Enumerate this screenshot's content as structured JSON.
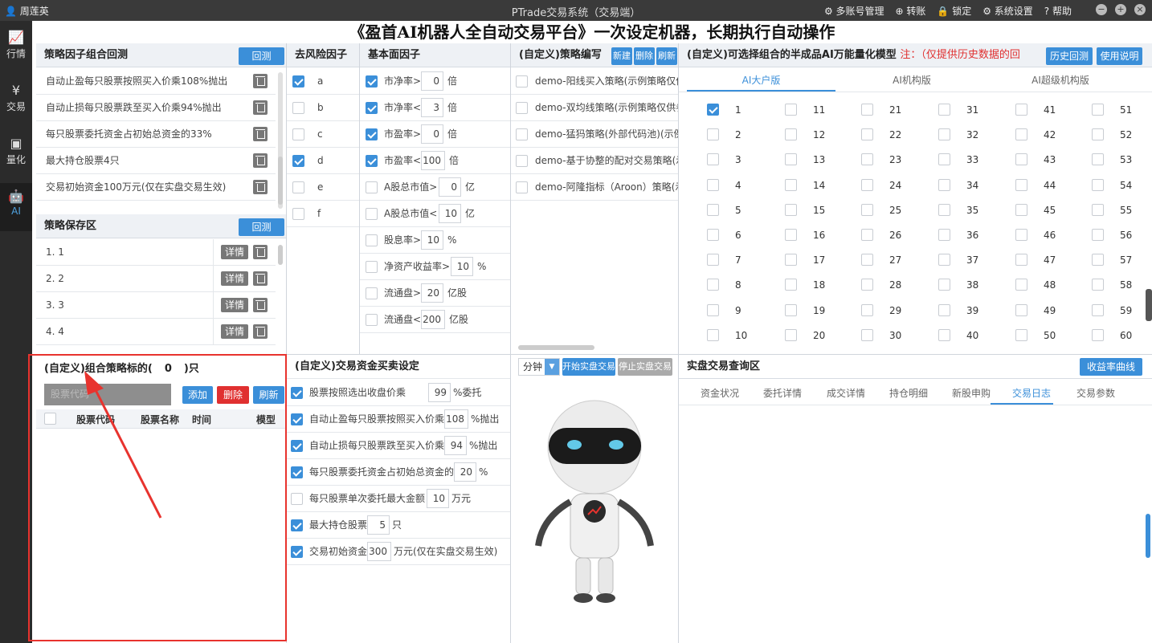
{
  "titlebar": {
    "user": "周莲英",
    "app_title": "PTrade交易系统（交易端）",
    "menu": [
      "多账号管理",
      "转账",
      "锁定",
      "系统设置",
      "帮助"
    ]
  },
  "sidebar": [
    {
      "label": "行情",
      "icon": "chart-icon"
    },
    {
      "label": "交易",
      "icon": "yen-icon"
    },
    {
      "label": "量化",
      "icon": "quant-icon"
    },
    {
      "label": "AI",
      "icon": "robot-icon"
    }
  ],
  "banner": "《盈首AI机器人全自动交易平台》一次设定机器，长期执行自动操作",
  "factor_backtest": {
    "title": "策略因子组合回测",
    "button": "回测",
    "items": [
      "自动止盈每只股票按照买入价乘108%抛出",
      "自动止损每只股票跌至买入价乘94%抛出",
      "每只股票委托资金占初始总资金的33%",
      "最大持仓股票4只",
      "交易初始资金100万元(仅在实盘交易生效)"
    ]
  },
  "strategy_save": {
    "title": "策略保存区",
    "button": "回测",
    "detail_label": "详情",
    "items": [
      "1.  1",
      "2.  2",
      "3.  3",
      "4.  4"
    ]
  },
  "custom_combo": {
    "title": "(自定义)组合策略标的(",
    "count": "0",
    "title_suffix": ")只",
    "input_placeholder": "股票代码",
    "add": "添加",
    "delete": "删除",
    "refresh": "刷新",
    "columns": [
      "股票代码",
      "股票名称",
      "时间",
      "模型"
    ]
  },
  "risk_factor": {
    "title": "去风险因子",
    "items": [
      {
        "label": "a",
        "checked": true
      },
      {
        "label": "b",
        "checked": false
      },
      {
        "label": "c",
        "checked": false
      },
      {
        "label": "d",
        "checked": true
      },
      {
        "label": "e",
        "checked": false
      },
      {
        "label": "f",
        "checked": false
      }
    ]
  },
  "fundamental": {
    "title": "基本面因子",
    "items": [
      {
        "label": "市净率>",
        "value": "0",
        "unit": "倍",
        "checked": true
      },
      {
        "label": "市净率<",
        "value": "3",
        "unit": "倍",
        "checked": true
      },
      {
        "label": "市盈率>",
        "value": "0",
        "unit": "倍",
        "checked": true
      },
      {
        "label": "市盈率<",
        "value": "100",
        "unit": "倍",
        "checked": true
      },
      {
        "label": "A股总市值>",
        "value": "0",
        "unit": "亿",
        "checked": false
      },
      {
        "label": "A股总市值<",
        "value": "10",
        "unit": "亿",
        "checked": false
      },
      {
        "label": "股息率>",
        "value": "10",
        "unit": "%",
        "checked": false
      },
      {
        "label": "净资产收益率>",
        "value": "10",
        "unit": "%",
        "checked": false
      },
      {
        "label": "流通盘>",
        "value": "20",
        "unit": "亿股",
        "checked": false
      },
      {
        "label": "流通盘<",
        "value": "200",
        "unit": "亿股",
        "checked": false
      }
    ]
  },
  "strategy_edit": {
    "title": "(自定义)策略编写",
    "new": "新建",
    "delete": "删除",
    "refresh": "刷新",
    "items": [
      "demo-阳线买入策略(示例策略仅供",
      "demo-双均线策略(示例策略仅供参",
      "demo-猛犸策略(外部代码池)(示例",
      "demo-基于协整的配对交易策略(示",
      "demo-阿隆指标（Aroon）策略(示"
    ]
  },
  "trade_settings": {
    "title": "(自定义)交易资金买卖设定",
    "items": [
      {
        "pre": "股票按照选出收盘价乘",
        "value": "99",
        "post": "%委托",
        "checked": true
      },
      {
        "pre": "自动止盈每只股票按照买入价乘",
        "value": "108",
        "post": "%抛出",
        "checked": true
      },
      {
        "pre": "自动止损每只股票跌至买入价乘",
        "value": "94",
        "post": "%抛出",
        "checked": true
      },
      {
        "pre": "每只股票委托资金占初始总资金的",
        "value": "20",
        "post": "%",
        "checked": true
      },
      {
        "pre": "每只股票单次委托最大金额",
        "value": "10",
        "post": "万元",
        "checked": false
      },
      {
        "pre": "最大持仓股票",
        "value": "5",
        "post": "只",
        "checked": true
      },
      {
        "pre": "交易初始资金",
        "value": "300",
        "post": "万元(仅在实盘交易生效)",
        "checked": true
      }
    ]
  },
  "realtime_ctrl": {
    "period": "分钟",
    "start": "开始实盘交易",
    "stop": "停止实盘交易"
  },
  "model_panel": {
    "title": "(自定义)可选择组合的半成品AI万能量化模型",
    "note": "注：（仅提供历史数据的回",
    "history_btn": "历史回测",
    "help_btn": "使用说明",
    "tabs": [
      "AI大户版",
      "AI机构版",
      "AI超级机构版"
    ],
    "checked": [
      1
    ]
  },
  "query": {
    "title": "实盘交易查询区",
    "button": "收益率曲线",
    "tabs": [
      "资金状况",
      "委托详情",
      "成交详情",
      "持仓明细",
      "新股申购",
      "交易日志",
      "交易参数"
    ],
    "active_tab": 5
  },
  "colors": {
    "accent": "#3b8fd9",
    "danger": "#e03030",
    "annotation": "#e8332e"
  }
}
